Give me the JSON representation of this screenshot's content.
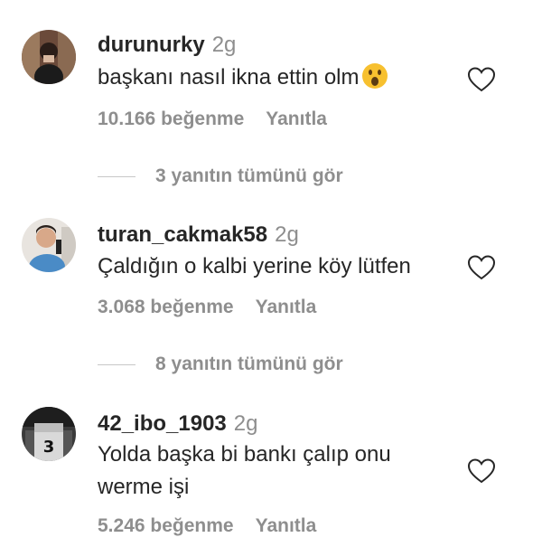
{
  "comments": [
    {
      "username": "durunurky",
      "time": "2g",
      "text": "başkanı nasıl ikna ettin olm",
      "emoji": "face-with-open-mouth",
      "likes": "10.166 beğenme",
      "reply": "Yanıtla",
      "view_replies": "3 yanıtın tümünü gör"
    },
    {
      "username": "turan_cakmak58",
      "time": "2g",
      "text": "Çaldığın o kalbi yerine köy lütfen",
      "likes": "3.068 beğenme",
      "reply": "Yanıtla",
      "view_replies": "8 yanıtın tümünü gör"
    },
    {
      "username": "42_ibo_1903",
      "time": "2g",
      "text_line1": "Yolda başka bi bankı çalıp onu",
      "text_line2": "werme işi",
      "likes": "5.246 beğenme",
      "reply": "Yanıtla"
    }
  ]
}
